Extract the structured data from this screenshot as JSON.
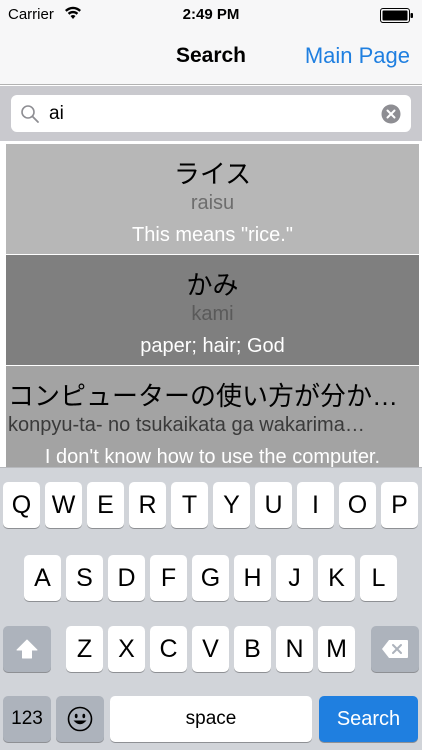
{
  "status_bar": {
    "carrier": "Carrier",
    "time": "2:49 PM"
  },
  "nav": {
    "title": "Search",
    "right_button": "Main Page",
    "accent_color": "#1f7fe0"
  },
  "search": {
    "value": "ai"
  },
  "results": [
    {
      "japanese": "ライス",
      "romaji": "raisu",
      "meaning": "This means \"rice.\""
    },
    {
      "japanese": "かみ",
      "romaji": "kami",
      "meaning": "paper; hair; God"
    },
    {
      "japanese": "コンピューターの使い方が分かり…",
      "romaji": "konpyu-ta- no tsukaikata ga wakarima…",
      "meaning": "I don't know how to use the computer."
    }
  ],
  "keyboard": {
    "row1": [
      "Q",
      "W",
      "E",
      "R",
      "T",
      "Y",
      "U",
      "I",
      "O",
      "P"
    ],
    "row2": [
      "A",
      "S",
      "D",
      "F",
      "G",
      "H",
      "J",
      "K",
      "L"
    ],
    "row3": [
      "Z",
      "X",
      "C",
      "V",
      "B",
      "N",
      "M"
    ],
    "numbers_label": "123",
    "space_label": "space",
    "search_label": "Search",
    "icons": [
      "shift-icon",
      "backspace-icon",
      "emoji-icon"
    ]
  }
}
